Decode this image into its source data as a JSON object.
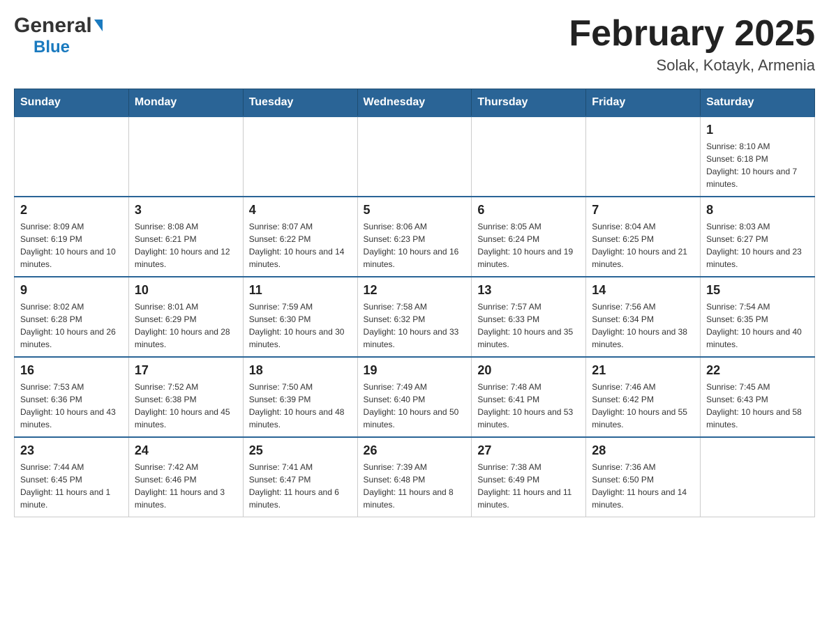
{
  "header": {
    "logo_general": "General",
    "logo_blue": "Blue",
    "month_title": "February 2025",
    "location": "Solak, Kotayk, Armenia"
  },
  "days_of_week": [
    "Sunday",
    "Monday",
    "Tuesday",
    "Wednesday",
    "Thursday",
    "Friday",
    "Saturday"
  ],
  "weeks": [
    {
      "days": [
        {
          "number": "",
          "info": "",
          "empty": true
        },
        {
          "number": "",
          "info": "",
          "empty": true
        },
        {
          "number": "",
          "info": "",
          "empty": true
        },
        {
          "number": "",
          "info": "",
          "empty": true
        },
        {
          "number": "",
          "info": "",
          "empty": true
        },
        {
          "number": "",
          "info": "",
          "empty": true
        },
        {
          "number": "1",
          "info": "Sunrise: 8:10 AM\nSunset: 6:18 PM\nDaylight: 10 hours and 7 minutes.",
          "empty": false
        }
      ]
    },
    {
      "days": [
        {
          "number": "2",
          "info": "Sunrise: 8:09 AM\nSunset: 6:19 PM\nDaylight: 10 hours and 10 minutes.",
          "empty": false
        },
        {
          "number": "3",
          "info": "Sunrise: 8:08 AM\nSunset: 6:21 PM\nDaylight: 10 hours and 12 minutes.",
          "empty": false
        },
        {
          "number": "4",
          "info": "Sunrise: 8:07 AM\nSunset: 6:22 PM\nDaylight: 10 hours and 14 minutes.",
          "empty": false
        },
        {
          "number": "5",
          "info": "Sunrise: 8:06 AM\nSunset: 6:23 PM\nDaylight: 10 hours and 16 minutes.",
          "empty": false
        },
        {
          "number": "6",
          "info": "Sunrise: 8:05 AM\nSunset: 6:24 PM\nDaylight: 10 hours and 19 minutes.",
          "empty": false
        },
        {
          "number": "7",
          "info": "Sunrise: 8:04 AM\nSunset: 6:25 PM\nDaylight: 10 hours and 21 minutes.",
          "empty": false
        },
        {
          "number": "8",
          "info": "Sunrise: 8:03 AM\nSunset: 6:27 PM\nDaylight: 10 hours and 23 minutes.",
          "empty": false
        }
      ]
    },
    {
      "days": [
        {
          "number": "9",
          "info": "Sunrise: 8:02 AM\nSunset: 6:28 PM\nDaylight: 10 hours and 26 minutes.",
          "empty": false
        },
        {
          "number": "10",
          "info": "Sunrise: 8:01 AM\nSunset: 6:29 PM\nDaylight: 10 hours and 28 minutes.",
          "empty": false
        },
        {
          "number": "11",
          "info": "Sunrise: 7:59 AM\nSunset: 6:30 PM\nDaylight: 10 hours and 30 minutes.",
          "empty": false
        },
        {
          "number": "12",
          "info": "Sunrise: 7:58 AM\nSunset: 6:32 PM\nDaylight: 10 hours and 33 minutes.",
          "empty": false
        },
        {
          "number": "13",
          "info": "Sunrise: 7:57 AM\nSunset: 6:33 PM\nDaylight: 10 hours and 35 minutes.",
          "empty": false
        },
        {
          "number": "14",
          "info": "Sunrise: 7:56 AM\nSunset: 6:34 PM\nDaylight: 10 hours and 38 minutes.",
          "empty": false
        },
        {
          "number": "15",
          "info": "Sunrise: 7:54 AM\nSunset: 6:35 PM\nDaylight: 10 hours and 40 minutes.",
          "empty": false
        }
      ]
    },
    {
      "days": [
        {
          "number": "16",
          "info": "Sunrise: 7:53 AM\nSunset: 6:36 PM\nDaylight: 10 hours and 43 minutes.",
          "empty": false
        },
        {
          "number": "17",
          "info": "Sunrise: 7:52 AM\nSunset: 6:38 PM\nDaylight: 10 hours and 45 minutes.",
          "empty": false
        },
        {
          "number": "18",
          "info": "Sunrise: 7:50 AM\nSunset: 6:39 PM\nDaylight: 10 hours and 48 minutes.",
          "empty": false
        },
        {
          "number": "19",
          "info": "Sunrise: 7:49 AM\nSunset: 6:40 PM\nDaylight: 10 hours and 50 minutes.",
          "empty": false
        },
        {
          "number": "20",
          "info": "Sunrise: 7:48 AM\nSunset: 6:41 PM\nDaylight: 10 hours and 53 minutes.",
          "empty": false
        },
        {
          "number": "21",
          "info": "Sunrise: 7:46 AM\nSunset: 6:42 PM\nDaylight: 10 hours and 55 minutes.",
          "empty": false
        },
        {
          "number": "22",
          "info": "Sunrise: 7:45 AM\nSunset: 6:43 PM\nDaylight: 10 hours and 58 minutes.",
          "empty": false
        }
      ]
    },
    {
      "days": [
        {
          "number": "23",
          "info": "Sunrise: 7:44 AM\nSunset: 6:45 PM\nDaylight: 11 hours and 1 minute.",
          "empty": false
        },
        {
          "number": "24",
          "info": "Sunrise: 7:42 AM\nSunset: 6:46 PM\nDaylight: 11 hours and 3 minutes.",
          "empty": false
        },
        {
          "number": "25",
          "info": "Sunrise: 7:41 AM\nSunset: 6:47 PM\nDaylight: 11 hours and 6 minutes.",
          "empty": false
        },
        {
          "number": "26",
          "info": "Sunrise: 7:39 AM\nSunset: 6:48 PM\nDaylight: 11 hours and 8 minutes.",
          "empty": false
        },
        {
          "number": "27",
          "info": "Sunrise: 7:38 AM\nSunset: 6:49 PM\nDaylight: 11 hours and 11 minutes.",
          "empty": false
        },
        {
          "number": "28",
          "info": "Sunrise: 7:36 AM\nSunset: 6:50 PM\nDaylight: 11 hours and 14 minutes.",
          "empty": false
        },
        {
          "number": "",
          "info": "",
          "empty": true
        }
      ]
    }
  ]
}
